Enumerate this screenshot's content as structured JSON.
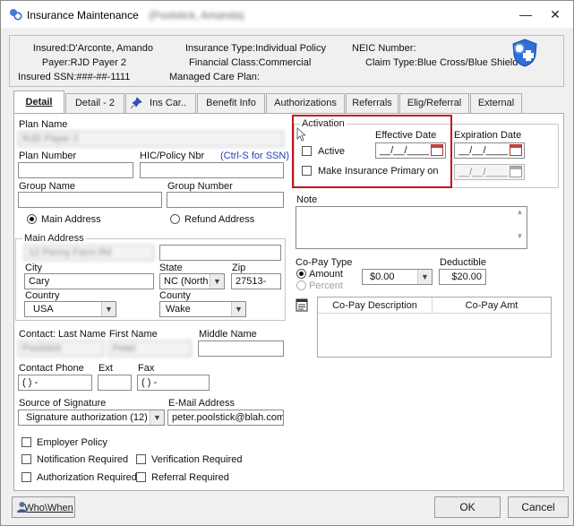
{
  "window": {
    "title": "Insurance Maintenance",
    "title_detail": "(Poolstick, Amanda)",
    "minimize_glyph": "—",
    "close_glyph": "✕"
  },
  "info": {
    "insured": "Insured:D'Arconte, Amando",
    "payer": "Payer:RJD Payer 2",
    "ssn": "Insured SSN:###-##-1111",
    "insurance_type": "Insurance Type:Individual Policy",
    "financial_class": "Financial Class:Commercial",
    "managed_care": "Managed Care Plan:",
    "neic": "NEIC Number:",
    "claim_type": "Claim Type:Blue Cross/Blue Shield"
  },
  "tabs": [
    {
      "label": "Detail",
      "active": true
    },
    {
      "label": "Detail - 2",
      "active": false
    },
    {
      "label": "Ins Car..",
      "active": false
    },
    {
      "label": "Benefit Info",
      "active": false
    },
    {
      "label": "Authorizations",
      "active": false
    },
    {
      "label": "Referrals",
      "active": false
    },
    {
      "label": "Elig/Referral",
      "active": false
    },
    {
      "label": "External",
      "active": false
    }
  ],
  "form": {
    "plan_name_label": "Plan Name",
    "plan_name_value": "RJD Payer 2",
    "plan_number_label": "Plan Number",
    "plan_number_value": "",
    "hic_label": "HIC/Policy Nbr",
    "hic_hint": "(Ctrl-S for SSN)",
    "hic_value": "",
    "group_name_label": "Group Name",
    "group_name_value": "",
    "group_number_label": "Group Number",
    "group_number_value": "",
    "main_address_radio": "Main Address",
    "refund_address_radio": "Refund Address",
    "address_group_title": "Main Address",
    "address_line1": "12 Penny Farm Rd",
    "address_line2": "",
    "city_label": "City",
    "city_value": "Cary",
    "state_label": "State",
    "state_value": "NC  (North",
    "zip_label": "Zip",
    "zip_value": "27513-",
    "country_label": "Country",
    "country_value": "USA",
    "county_label": "County",
    "county_value": "Wake",
    "contact_last_label": "Contact: Last Name",
    "contact_last_value": "Poolstick",
    "first_name_label": "First Name",
    "first_name_value": "Peter",
    "middle_name_label": "Middle Name",
    "middle_name_value": "",
    "contact_phone_label": "Contact Phone",
    "contact_phone_value": "(  )     -",
    "ext_label": "Ext",
    "ext_value": "",
    "fax_label": "Fax",
    "fax_value": "(  )     -",
    "source_signature_label": "Source of Signature",
    "source_signature_value": "Signature authorization (12)",
    "email_label": "E-Mail Address",
    "email_value": "peter.poolstick@blah.com",
    "employer_policy": "Employer Policy",
    "notification_required": "Notification Required",
    "verification_required": "Verification Required",
    "authorization_required": "Authorization Required",
    "referral_required": "Referral Required"
  },
  "activation": {
    "title": "Activation",
    "effective_date_label": "Effective Date",
    "effective_date_value": "__/__/____",
    "active_label": "Active",
    "make_primary_label": "Make Insurance Primary on",
    "expiration_date_label": "Expiration Date",
    "expiration_date_value": "__/__/____",
    "primary_date_value": "__/__/____"
  },
  "note": {
    "label": "Note",
    "value": ""
  },
  "copay": {
    "type_label": "Co-Pay Type",
    "amount_radio": "Amount",
    "percent_radio": "Percent",
    "amount_value": "$0.00",
    "deductible_label": "Deductible",
    "deductible_value": "$20.00",
    "col_description": "Co-Pay Description",
    "col_amount": "Co-Pay Amt"
  },
  "buttons": {
    "who_when": "Who\\When",
    "ok": "OK",
    "cancel": "Cancel"
  },
  "colors": {
    "highlight": "#c8121d",
    "link": "#1f3fbf",
    "shield": "#2f6fd8"
  }
}
